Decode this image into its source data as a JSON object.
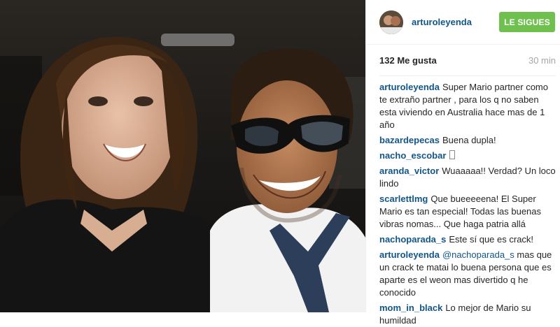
{
  "post": {
    "username": "arturoleyenda",
    "follow_label": "LE SIGUES",
    "likes_count": "132",
    "likes_suffix": "Me gusta",
    "time_ago": "30 min"
  },
  "comments": [
    {
      "user": "arturoleyenda",
      "text": "Super Mario partner como te extraño partner , para los q no saben esta viviendo en Australia hace mas de 1 año"
    },
    {
      "user": "bazardepecas",
      "text": "Buena dupla!"
    },
    {
      "user": "nacho_escobar",
      "text": ""
    },
    {
      "user": "aranda_victor",
      "text": "Wuaaaaa!! Verdad? Un loco lindo"
    },
    {
      "user": "scarlettlmg",
      "text": "Que bueeeeena! El Super Mario es tan especial! Todas las buenas vibras nomas... Que haga patria allá"
    },
    {
      "user": "nachoparada_s",
      "text": "Este sí que es crack!"
    },
    {
      "user": "arturoleyenda",
      "mention": "@nachoparada_s",
      "text": " mas que un crack te matai lo buena persona que es aparte es el weon mas divertido q he conocido"
    },
    {
      "user": "mom_in_black",
      "text": "Lo mejor de Mario su humildad"
    }
  ],
  "colors": {
    "link": "#125688",
    "follow_bg": "#70c050",
    "muted": "#a5a7aa"
  },
  "icons": {
    "emoji_placeholder": "emoji-box-icon"
  }
}
